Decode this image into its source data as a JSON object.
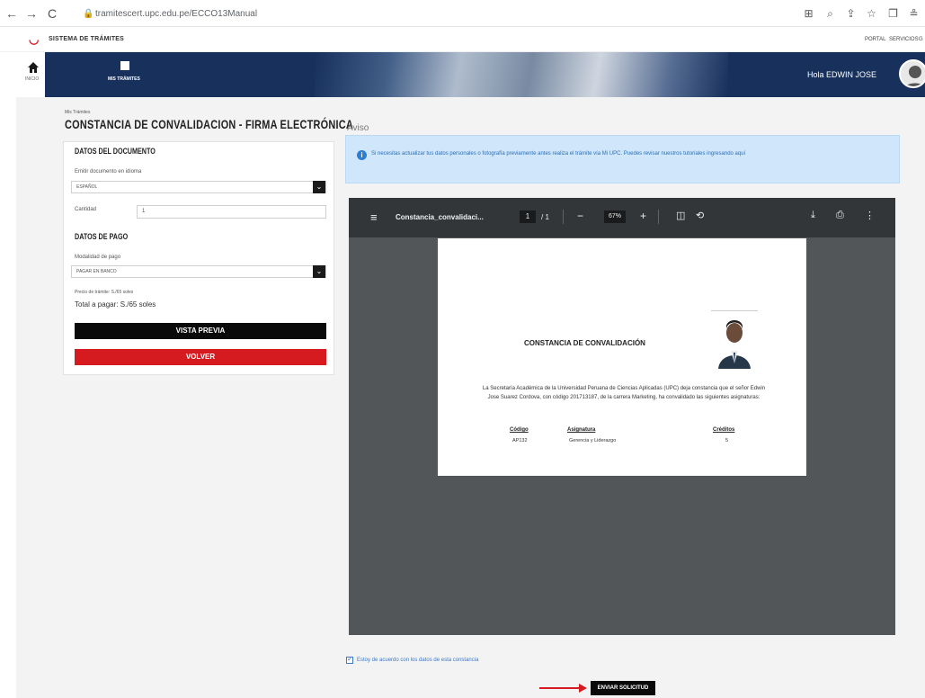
{
  "browser": {
    "url": "tramitescert.upc.edu.pe/ECCO13Manual"
  },
  "site": {
    "system_title": "SISTEMA DE TRÁMITES",
    "top_links": [
      "PORTAL",
      "SERVICIOS",
      "G"
    ],
    "rail_home_label": "INICIO",
    "menu_label": "MIS TRÁMITES",
    "greeting": "Hola EDWIN JOSE"
  },
  "form": {
    "breadcrumb": "Mis Trámites",
    "title": "CONSTANCIA DE CONVALIDACION - FIRMA ELECTRÓNICA",
    "doc_section": "DATOS DEL DOCUMENTO",
    "language_label": "Emitir documento en idioma",
    "language_value": "ESPAÑOL",
    "quantity_label": "Cantidad",
    "quantity_value": "1",
    "payment_section": "DATOS DE PAGO",
    "payment_mode_label": "Modalidad de pago",
    "payment_mode_value": "PAGAR EN BANCO",
    "unit_price": "Precio de trámite: S./65 soles",
    "total": "Total a pagar: S./65 soles",
    "preview_button": "VISTA PREVIA",
    "back_button": "VOLVER"
  },
  "notice": {
    "heading": "Aviso",
    "text": "Si necesitas actualizar tus datos personales o fotografía previamente antes realiza el trámite vía Mi UPC. Puedes revisar nuestros tutoriales ingresando aquí"
  },
  "pdf": {
    "filename": "Constancia_convalidaci...",
    "page_current": "1",
    "page_total": "/ 1",
    "zoom": "67%",
    "doc_title": "CONSTANCIA DE CONVALIDACIÓN",
    "doc_body": "La Secretaría Académica de la Universidad Peruana de Ciencias Aplicadas (UPC) deja constancia que el señor Edwin Jose Suarez Cordova, con código 201713187, de la carrera Marketing, ha convalidado las siguientes asignaturas:",
    "table": {
      "headers": [
        "Código",
        "Asignatura",
        "Créditos"
      ],
      "rows": [
        [
          "AP132",
          "Gerencia y Liderazgo",
          "5"
        ]
      ]
    }
  },
  "agreement_label": "Estoy de acuerdo con los datos de esta constancia",
  "send_button": "ENVIAR SOLICITUD"
}
